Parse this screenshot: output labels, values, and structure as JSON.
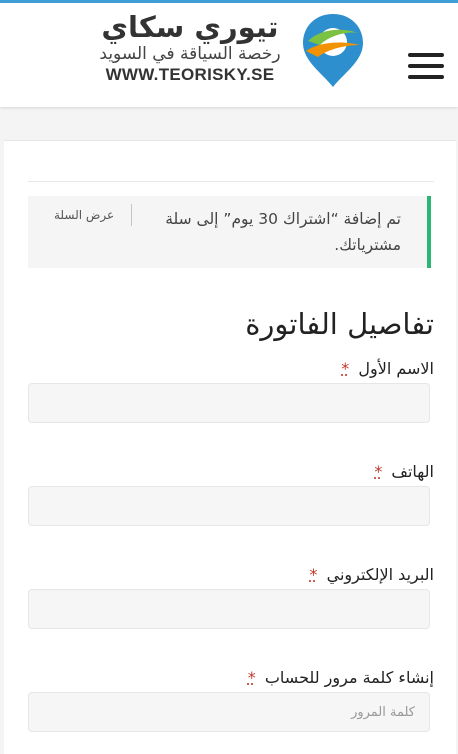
{
  "header": {
    "logo_title": "تيوري سكاي",
    "logo_subtitle": "رخصة السياقة في السويد",
    "logo_url": "WWW.TEORISKY.SE",
    "menu_icon": "hamburger-menu-icon",
    "brand_colors": {
      "accent_blue": "#3fa0d8",
      "logo_green": "#7cc242",
      "logo_orange": "#f39200"
    }
  },
  "notice": {
    "message": "تم إضافة “اشتراك 30 يوم” إلى سلة مشترياتك.",
    "view_cart_link": "عرض السلة",
    "accent_color": "#2bb673"
  },
  "billing": {
    "title": "تفاصيل الفاتورة",
    "required_mark": "*",
    "fields": [
      {
        "label": "الاسم الأول",
        "value": "",
        "placeholder": ""
      },
      {
        "label": "الهاتف",
        "value": "",
        "placeholder": ""
      },
      {
        "label": "البريد الإلكتروني",
        "value": "",
        "placeholder": ""
      },
      {
        "label": "إنشاء كلمة مرور للحساب",
        "value": "",
        "placeholder": "كلمة المرور"
      }
    ]
  }
}
